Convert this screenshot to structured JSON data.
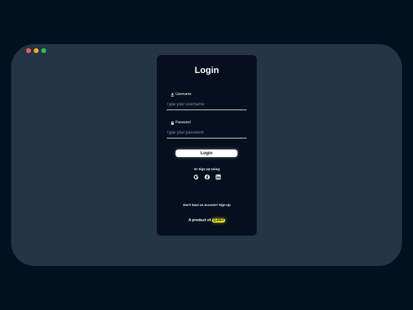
{
  "window": {
    "background": "#253447",
    "traffic_lights": [
      "#ee5d5d",
      "#e6b523",
      "#2ec14f"
    ]
  },
  "login": {
    "title": "Login",
    "username": {
      "label": "Username",
      "icon": "user-icon",
      "placeholder": "Type your username",
      "value": ""
    },
    "password": {
      "label": "Password",
      "icon": "lock-icon",
      "placeholder": "Type your password",
      "value": ""
    },
    "submit_label": "Login",
    "social_text": "Or Sign Up Using",
    "social_icons": [
      "google-icon",
      "facebook-icon",
      "linkedin-icon"
    ],
    "account_text": "Don't have an account?",
    "signup_link": "Sign Up",
    "product_text": "A product of",
    "brand_badge": "Q.DEV"
  },
  "colors": {
    "page_bg": "#021120",
    "card_bg": "#050f1d",
    "accent": "#f2e81f"
  }
}
